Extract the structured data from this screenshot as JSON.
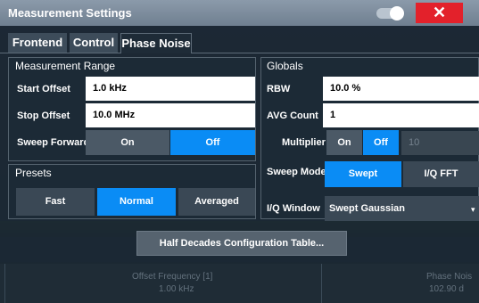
{
  "dialog": {
    "title": "Measurement Settings",
    "close_glyph": "✕"
  },
  "tabs": [
    {
      "label": "Frontend"
    },
    {
      "label": "Control"
    },
    {
      "label": "Phase Noise"
    }
  ],
  "measurement_range": {
    "title": "Measurement Range",
    "start_offset_label": "Start Offset",
    "start_offset_value": "1.0 kHz",
    "stop_offset_label": "Stop Offset",
    "stop_offset_value": "10.0 MHz",
    "sweep_forward_label": "Sweep Forward",
    "sweep_forward_on": "On",
    "sweep_forward_off": "Off",
    "sweep_forward_selected": "Off"
  },
  "presets": {
    "title": "Presets",
    "fast": "Fast",
    "normal": "Normal",
    "averaged": "Averaged",
    "selected": "Normal"
  },
  "globals": {
    "title": "Globals",
    "rbw_label": "RBW",
    "rbw_value": "10.0 %",
    "avg_count_label": "AVG Count",
    "avg_count_value": "1",
    "multiplier_label": "Multiplier",
    "multiplier_on": "On",
    "multiplier_off": "Off",
    "multiplier_selected": "Off",
    "multiplier_value": "10",
    "sweep_mode_label": "Sweep Mode",
    "sweep_mode_swept": "Swept",
    "sweep_mode_iqfft": "I/Q FFT",
    "sweep_mode_selected": "Swept",
    "iq_window_label": "I/Q Window",
    "iq_window_value": "Swept Gaussian"
  },
  "half_decades_button": "Half Decades Configuration Table...",
  "background": {
    "table_header_left": "Offset Frequency [1]",
    "table_header_right": "Phase Nois",
    "table_value_left": "1.00 kHz",
    "table_value_right": "102.90 d"
  },
  "colors": {
    "accent": "#0a8cf5",
    "close": "#e3212b",
    "titlebar": "#7d8c9c"
  },
  "icons": {
    "close": "close-icon",
    "toggle": "toggle-icon",
    "dropdown": "chevron-down-icon"
  }
}
